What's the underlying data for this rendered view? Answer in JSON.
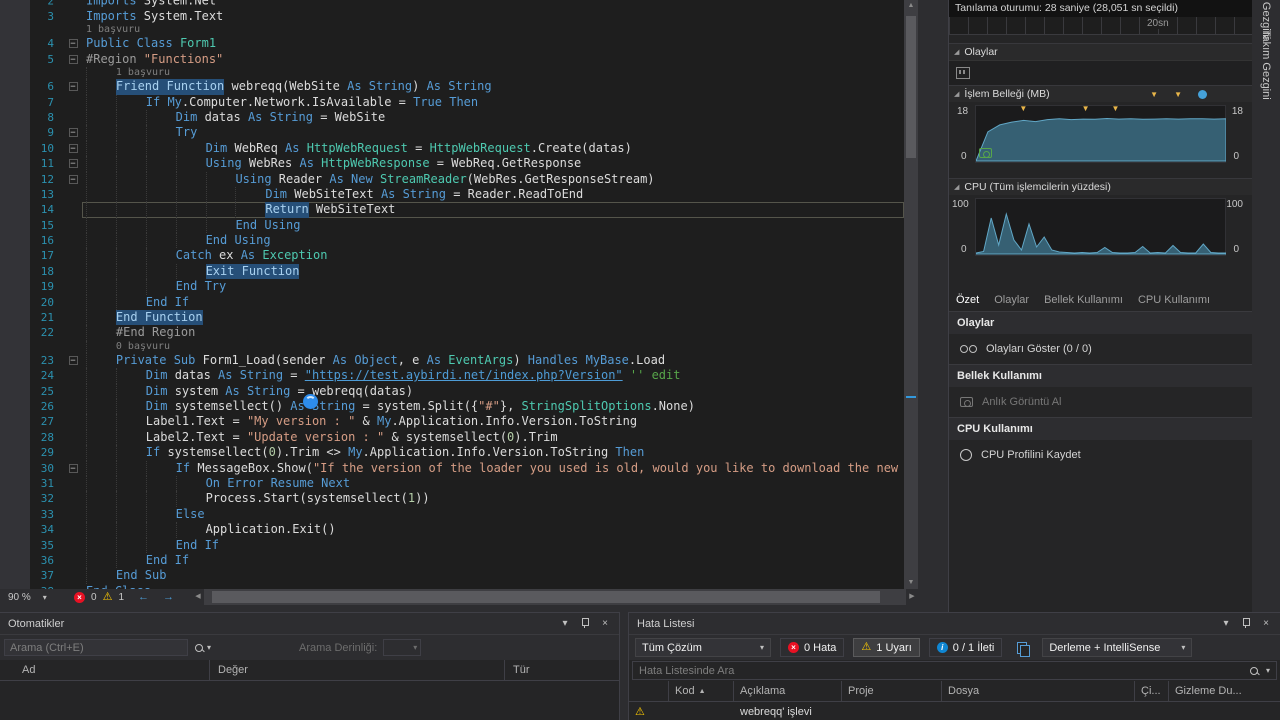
{
  "window": {
    "background": "#2D2D30",
    "accent": "#007ACC",
    "editor_bg": "#1E1E1E"
  },
  "colors": {
    "keyword": "#569CD6",
    "type": "#4EC9B0",
    "string": "#D69D85",
    "comment": "#57A64A",
    "line_number": "#2B91AF",
    "selection": "#264F78",
    "error_red": "#E81123",
    "warning_yellow": "#FFCC00",
    "info_blue": "#0F86D2"
  },
  "icons": {
    "close": "×",
    "caret": "▾",
    "warning": "⚠",
    "info": "i",
    "error": "×",
    "sort": "▲",
    "back": "←",
    "fwd": "→",
    "marker": "▼",
    "collapse": "◢",
    "minus": "−",
    "up": "▲",
    "down": "▼",
    "left": "◀",
    "right": "▶"
  },
  "editor": {
    "zoom_level": "90 %",
    "error_count": "0",
    "warning_count": "1",
    "rows": [
      {
        "n": "2",
        "ind": 0,
        "cut": true,
        "seg": [
          [
            "k",
            "Imports"
          ],
          [
            "p",
            " System.Net"
          ]
        ]
      },
      {
        "n": "3",
        "ind": 0,
        "seg": [
          [
            "k",
            "Imports"
          ],
          [
            "p",
            " System.Text"
          ]
        ]
      },
      {
        "lens": "1 başvuru",
        "ind": 0
      },
      {
        "n": "4",
        "ind": 0,
        "fold": true,
        "seg": [
          [
            "k",
            "Public Class"
          ],
          [
            "p",
            " "
          ],
          [
            "t",
            "Form1"
          ]
        ]
      },
      {
        "n": "5",
        "ind": 0,
        "fold": true,
        "seg": [
          [
            "d",
            "#Region "
          ],
          [
            "s",
            "\"Functions\""
          ]
        ]
      },
      {
        "lens": "1 başvuru",
        "ind": 1
      },
      {
        "n": "6",
        "ind": 1,
        "fold": true,
        "seg": [
          [
            "ks",
            "Friend Function"
          ],
          [
            "p",
            " webreqq(WebSite "
          ],
          [
            "k",
            "As String"
          ],
          [
            "p",
            ") "
          ],
          [
            "k",
            "As String"
          ]
        ]
      },
      {
        "n": "7",
        "ind": 2,
        "seg": [
          [
            "k",
            "If My"
          ],
          [
            "p",
            ".Computer.Network.IsAvailable = "
          ],
          [
            "k",
            "True"
          ],
          [
            "p",
            " "
          ],
          [
            "k",
            "Then"
          ]
        ]
      },
      {
        "n": "8",
        "ind": 3,
        "seg": [
          [
            "k",
            "Dim"
          ],
          [
            "p",
            " datas "
          ],
          [
            "k",
            "As String"
          ],
          [
            "p",
            " = WebSite"
          ]
        ]
      },
      {
        "n": "9",
        "ind": 3,
        "fold": true,
        "seg": [
          [
            "k",
            "Try"
          ]
        ]
      },
      {
        "n": "10",
        "ind": 4,
        "fold": true,
        "seg": [
          [
            "k",
            "Dim"
          ],
          [
            "p",
            " WebReq "
          ],
          [
            "k",
            "As"
          ],
          [
            "p",
            " "
          ],
          [
            "t",
            "HttpWebRequest"
          ],
          [
            "p",
            " = "
          ],
          [
            "t",
            "HttpWebRequest"
          ],
          [
            "p",
            ".Create(datas)"
          ]
        ]
      },
      {
        "n": "11",
        "ind": 4,
        "fold": true,
        "seg": [
          [
            "k",
            "Using"
          ],
          [
            "p",
            " WebRes "
          ],
          [
            "k",
            "As"
          ],
          [
            "p",
            " "
          ],
          [
            "t",
            "HttpWebResponse"
          ],
          [
            "p",
            " = WebReq.GetResponse"
          ]
        ]
      },
      {
        "n": "12",
        "ind": 5,
        "fold": true,
        "seg": [
          [
            "k",
            "Using"
          ],
          [
            "p",
            " Reader "
          ],
          [
            "k",
            "As New"
          ],
          [
            "p",
            " "
          ],
          [
            "t",
            "StreamReader"
          ],
          [
            "p",
            "(WebRes.GetResponseStream)"
          ]
        ]
      },
      {
        "n": "13",
        "ind": 6,
        "seg": [
          [
            "k",
            "Dim"
          ],
          [
            "p",
            " WebSiteText "
          ],
          [
            "k",
            "As String"
          ],
          [
            "p",
            " = Reader.ReadToEnd"
          ]
        ]
      },
      {
        "n": "14",
        "ind": 6,
        "cur": true,
        "seg": [
          [
            "ks",
            "Return"
          ],
          [
            "p",
            " WebSiteText"
          ]
        ]
      },
      {
        "n": "15",
        "ind": 5,
        "seg": [
          [
            "k",
            "End Using"
          ]
        ]
      },
      {
        "n": "16",
        "ind": 4,
        "seg": [
          [
            "k",
            "End Using"
          ]
        ]
      },
      {
        "n": "17",
        "ind": 3,
        "seg": [
          [
            "k",
            "Catch"
          ],
          [
            "p",
            " ex "
          ],
          [
            "k",
            "As"
          ],
          [
            "p",
            " "
          ],
          [
            "t",
            "Exception"
          ]
        ]
      },
      {
        "n": "18",
        "ind": 4,
        "seg": [
          [
            "ks",
            "Exit Function"
          ]
        ]
      },
      {
        "n": "19",
        "ind": 3,
        "seg": [
          [
            "k",
            "End Try"
          ]
        ]
      },
      {
        "n": "20",
        "ind": 2,
        "seg": [
          [
            "k",
            "End If"
          ]
        ]
      },
      {
        "n": "21",
        "ind": 1,
        "seg": [
          [
            "ks",
            "End Function"
          ]
        ]
      },
      {
        "n": "22",
        "ind": 1,
        "seg": [
          [
            "d",
            "#End Region"
          ]
        ]
      },
      {
        "lens": "0 başvuru",
        "ind": 1
      },
      {
        "n": "23",
        "ind": 1,
        "fold": true,
        "seg": [
          [
            "k",
            "Private Sub"
          ],
          [
            "p",
            " Form1_Load(sender "
          ],
          [
            "k",
            "As Object"
          ],
          [
            "p",
            ", e "
          ],
          [
            "k",
            "As"
          ],
          [
            "p",
            " "
          ],
          [
            "t",
            "EventArgs"
          ],
          [
            "p",
            ") "
          ],
          [
            "k",
            "Handles MyBase"
          ],
          [
            "p",
            ".Load"
          ]
        ]
      },
      {
        "n": "24",
        "ind": 2,
        "seg": [
          [
            "k",
            "Dim"
          ],
          [
            "p",
            " datas "
          ],
          [
            "k",
            "As String"
          ],
          [
            "p",
            " = "
          ],
          [
            "u",
            "\"https://test.aybirdi.net/index.php?Version\""
          ],
          [
            "p",
            " "
          ],
          [
            "c",
            "'' edit"
          ]
        ]
      },
      {
        "n": "25",
        "ind": 2,
        "seg": [
          [
            "k",
            "Dim"
          ],
          [
            "p",
            " system "
          ],
          [
            "k",
            "As String"
          ],
          [
            "p",
            " = webreqq(datas)"
          ]
        ]
      },
      {
        "n": "26",
        "ind": 2,
        "seg": [
          [
            "k",
            "Dim"
          ],
          [
            "p",
            " systemsellect() "
          ],
          [
            "k",
            "As String"
          ],
          [
            "p",
            " = system.Split({"
          ],
          [
            "s",
            "\"#\""
          ],
          [
            "p",
            "}, "
          ],
          [
            "t",
            "StringSplitOptions"
          ],
          [
            "p",
            ".None)"
          ]
        ]
      },
      {
        "n": "27",
        "ind": 2,
        "seg": [
          [
            "p",
            "Label1.Text = "
          ],
          [
            "s",
            "\"My version : \""
          ],
          [
            "p",
            " & "
          ],
          [
            "k",
            "My"
          ],
          [
            "p",
            ".Application.Info.Version.ToString"
          ]
        ]
      },
      {
        "n": "28",
        "ind": 2,
        "seg": [
          [
            "p",
            "Label2.Text = "
          ],
          [
            "s",
            "\"Update version : \""
          ],
          [
            "p",
            " & systemsellect("
          ],
          [
            "nu",
            "0"
          ],
          [
            "p",
            ").Trim"
          ]
        ]
      },
      {
        "n": "29",
        "ind": 2,
        "seg": [
          [
            "k",
            "If"
          ],
          [
            "p",
            " systemsellect("
          ],
          [
            "nu",
            "0"
          ],
          [
            "p",
            ").Trim <> "
          ],
          [
            "k",
            "My"
          ],
          [
            "p",
            ".Application.Info.Version.ToString "
          ],
          [
            "k",
            "Then"
          ]
        ]
      },
      {
        "n": "30",
        "ind": 3,
        "fold": true,
        "seg": [
          [
            "k",
            "If"
          ],
          [
            "p",
            " MessageBox.Show("
          ],
          [
            "s",
            "\"If the version of the loader you used is old, would you like to download the new version loader?"
          ]
        ]
      },
      {
        "n": "31",
        "ind": 4,
        "seg": [
          [
            "k",
            "On Error Resume Next"
          ]
        ]
      },
      {
        "n": "32",
        "ind": 4,
        "seg": [
          [
            "p",
            "Process.Start(systemsellect("
          ],
          [
            "nu",
            "1"
          ],
          [
            "p",
            "))"
          ]
        ]
      },
      {
        "n": "33",
        "ind": 3,
        "seg": [
          [
            "k",
            "Else"
          ]
        ]
      },
      {
        "n": "34",
        "ind": 4,
        "seg": [
          [
            "p",
            "Application.Exit()"
          ]
        ]
      },
      {
        "n": "35",
        "ind": 3,
        "seg": [
          [
            "k",
            "End If"
          ]
        ]
      },
      {
        "n": "36",
        "ind": 2,
        "seg": [
          [
            "k",
            "End If"
          ]
        ]
      },
      {
        "n": "37",
        "ind": 1,
        "seg": [
          [
            "k",
            "End Sub"
          ]
        ]
      },
      {
        "n": "38",
        "ind": 0,
        "seg": [
          [
            "k",
            "End Class"
          ]
        ]
      }
    ]
  },
  "diagnostics": {
    "session_label": "Tanılama oturumu: 28 saniye (28,051 sn seçildi)",
    "timeline_tick": "20sn",
    "events_header": "Olaylar",
    "memory_header": "İşlem Belleği (MB)",
    "cpu_header": "CPU (Tüm işlemcilerin yüzdesi)",
    "memory_max": "18",
    "memory_min": "0",
    "cpu_max": "100",
    "cpu_min": "0",
    "tabs": [
      "Özet",
      "Olaylar",
      "Bellek Kullanımı",
      "CPU Kullanımı"
    ],
    "summary": {
      "events_section": "Olaylar",
      "events_link": "Olayları Göster (0 / 0)",
      "memory_section": "Bellek Kullanımı",
      "memory_link": "Anlık Görüntü Al",
      "cpu_section": "CPU Kullanımı",
      "cpu_link": "CPU Profilini Kaydet"
    },
    "memory_marker_positions_pct": [
      19,
      44,
      56
    ],
    "chart_data": [
      {
        "type": "area",
        "name": "memory",
        "title": "İşlem Belleği (MB)",
        "ylim": [
          0,
          18
        ],
        "values": [
          0,
          10.5,
          13,
          14,
          14.6,
          14.2,
          14.9,
          15.2,
          14.9,
          15.1,
          15,
          15.3,
          15.1,
          15.2,
          15,
          15.1,
          15.2,
          15.1,
          15.2,
          15.2,
          15.1,
          15.2
        ]
      },
      {
        "type": "area",
        "name": "cpu",
        "title": "CPU (Tüm işlemcilerin yüzdesi)",
        "ylim": [
          0,
          100
        ],
        "values": [
          2,
          5,
          72,
          18,
          80,
          28,
          8,
          60,
          14,
          34,
          8,
          4,
          3,
          2,
          3,
          2,
          3,
          13,
          3,
          2,
          2,
          3,
          15,
          2,
          3,
          2,
          17,
          3,
          2,
          2,
          20,
          3,
          2,
          2
        ]
      }
    ]
  },
  "right_tabs": {
    "tab1": "Çözüm Gezgini",
    "tab2": "Takım Gezgini"
  },
  "autos": {
    "title": "Otomatikler",
    "search_placeholder": "Arama (Ctrl+E)",
    "depth_label": "Arama Derinliği:",
    "columns": [
      "Ad",
      "Değer",
      "Tür"
    ]
  },
  "error_list": {
    "title": "Hata Listesi",
    "scope": "Tüm Çözüm",
    "errors_label": "0 Hata",
    "warnings_label": "1 Uyarı",
    "messages_label": "0 / 1 İleti",
    "source": "Derleme + IntelliSense",
    "search_placeholder": "Hata Listesinde Ara",
    "columns": [
      "",
      "Kod",
      "Açıklama",
      "Proje",
      "Dosya",
      "Çi...",
      "Gizleme Du..."
    ],
    "rows": [
      {
        "description": "webreqq' işlevi"
      }
    ]
  }
}
